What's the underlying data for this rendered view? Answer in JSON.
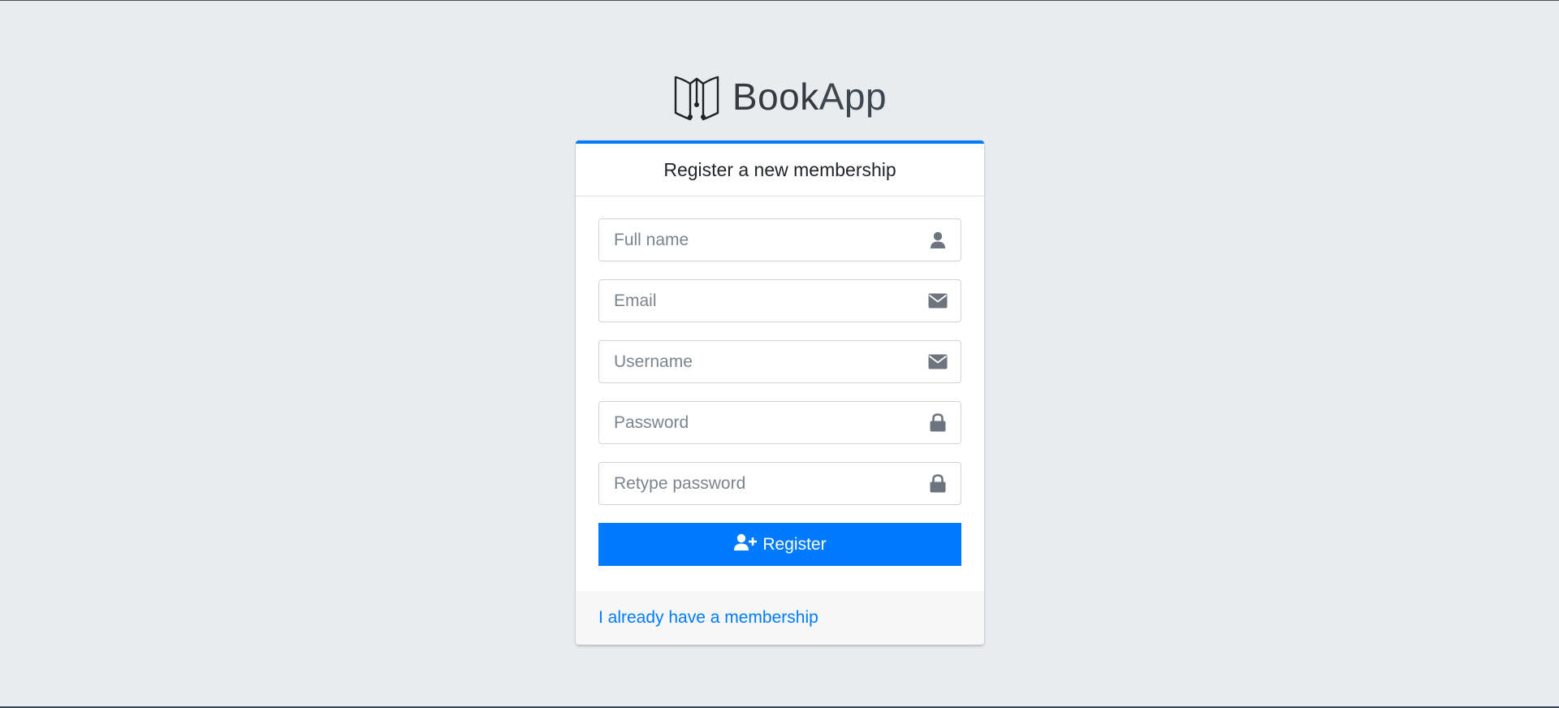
{
  "brand": {
    "name_bold": "Book",
    "name_light": "App",
    "logo_icon": "open-book-icon"
  },
  "card": {
    "title": "Register a new membership",
    "accent_color": "#007bff"
  },
  "fields": [
    {
      "placeholder": "Full name",
      "value": "",
      "icon": "user-icon"
    },
    {
      "placeholder": "Email",
      "value": "",
      "icon": "envelope-icon"
    },
    {
      "placeholder": "Username",
      "value": "",
      "icon": "envelope-icon"
    },
    {
      "placeholder": "Password",
      "value": "",
      "icon": "lock-icon"
    },
    {
      "placeholder": "Retype password",
      "value": "",
      "icon": "lock-icon"
    }
  ],
  "register_button": {
    "label": "Register",
    "icon": "user-plus-icon"
  },
  "footer": {
    "link_label": "I already have a membership"
  }
}
